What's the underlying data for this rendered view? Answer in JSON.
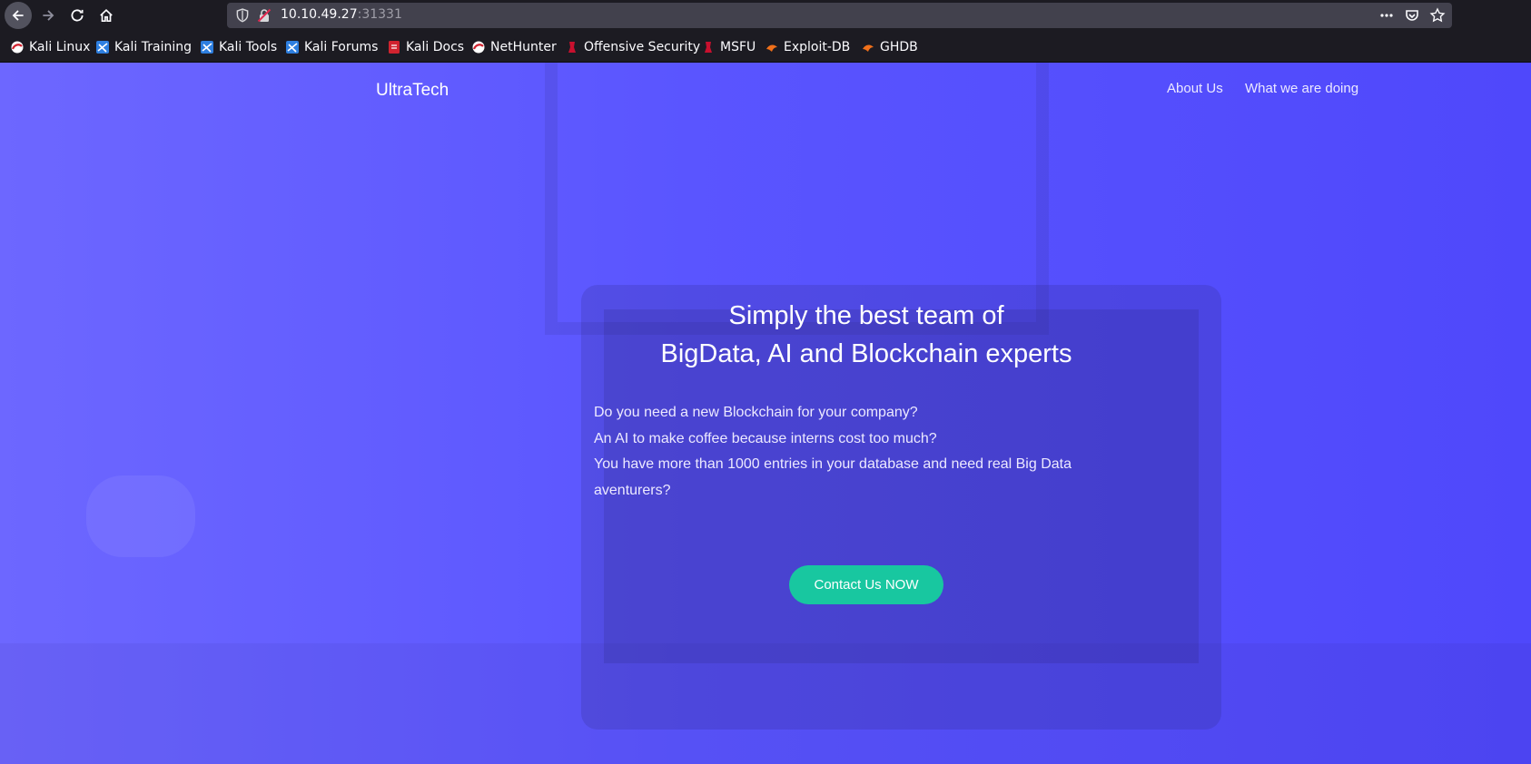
{
  "browser": {
    "url_host": "10.10.49.27",
    "url_port": ":31331",
    "bookmarks": [
      {
        "label": "Kali Linux",
        "icon": "kali-icon"
      },
      {
        "label": "Kali Training",
        "icon": "kali-training-icon"
      },
      {
        "label": "Kali Tools",
        "icon": "kali-tools-icon"
      },
      {
        "label": "Kali Forums",
        "icon": "kali-forums-icon"
      },
      {
        "label": "Kali Docs",
        "icon": "kali-docs-icon"
      },
      {
        "label": "NetHunter",
        "icon": "nethunter-icon"
      },
      {
        "label": "Offensive Security",
        "icon": "offsec-icon"
      },
      {
        "label": "MSFU",
        "icon": "msfu-icon"
      },
      {
        "label": "Exploit-DB",
        "icon": "exploit-db-icon"
      },
      {
        "label": "GHDB",
        "icon": "ghdb-icon"
      }
    ]
  },
  "site": {
    "brand": "UltraTech",
    "nav": [
      "About Us",
      "What we are doing"
    ],
    "hero": {
      "title_line1": "Simply the best team of",
      "title_line2": "BigData, AI and Blockchain experts",
      "lines": [
        "Do you need a new Blockchain for your company?",
        "An AI to make coffee because interns cost too much?",
        "You have more than 1000 entries in your database and need real Big Data aventurers?"
      ],
      "cta": "Contact Us NOW"
    }
  },
  "colors": {
    "hero_bg": "#5a55ff",
    "cta": "#18c7a0",
    "toolbar": "#1c1b22",
    "urlbar": "#42414d"
  }
}
